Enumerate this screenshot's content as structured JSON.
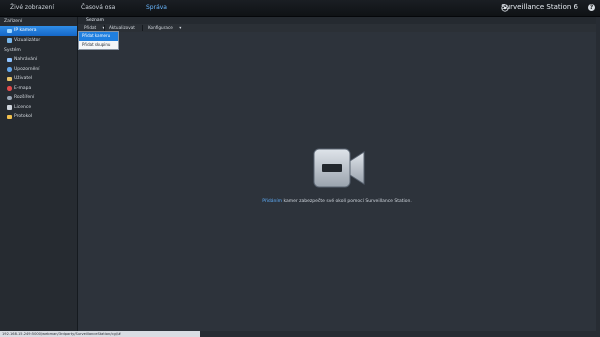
{
  "topbar": {
    "tabs": [
      {
        "label": "Živé zobrazení"
      },
      {
        "label": "Časová osa"
      },
      {
        "label": "Správa"
      }
    ],
    "brand": "Surveillance Station 6",
    "help_label": "?"
  },
  "sidebar": {
    "device_section": "Zařízení",
    "device_items": [
      {
        "label": "IP kamera",
        "icon": "ip-camera-icon",
        "active": true
      },
      {
        "label": "Vizualizátor",
        "icon": "visualizer-icon"
      }
    ],
    "system_section": "Systém",
    "system_items": [
      {
        "label": "Nahrávání",
        "icon": "recording-icon"
      },
      {
        "label": "Upozornění",
        "icon": "notification-icon"
      },
      {
        "label": "Uživatel",
        "icon": "user-icon"
      },
      {
        "label": "E-mapa",
        "icon": "emap-icon"
      },
      {
        "label": "Rozšíření",
        "icon": "extension-icon"
      },
      {
        "label": "Licence",
        "icon": "license-key-icon"
      },
      {
        "label": "Protokol",
        "icon": "log-icon"
      }
    ]
  },
  "main": {
    "title": "Seznam",
    "toolbar": {
      "add_label": "Přidat",
      "update_label": "Aktualizovat",
      "config_label": "Konfigurace"
    },
    "dropdown": [
      {
        "label": "Přidat kameru",
        "active": true
      },
      {
        "label": "Přidat skupinu"
      }
    ],
    "empty_message": {
      "link": "Přidáním",
      "text": " kamer zabezpečte své okolí pomocí Surveillance Station."
    }
  },
  "statusbar": {
    "url": "192.168.15.249:5000/webman/3rdparty/SurveillanceStation/cgi/#"
  },
  "colors": {
    "accent": "#2f8ee8",
    "active_tab": "#69b7ff",
    "link": "#5fb1ff"
  }
}
